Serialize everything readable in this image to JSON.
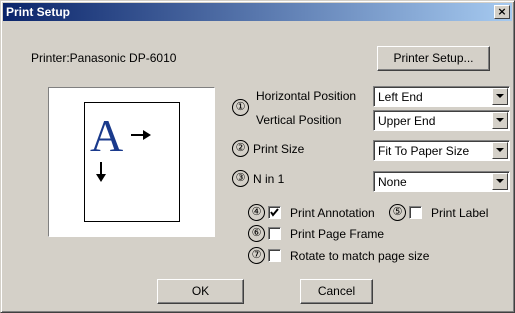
{
  "window": {
    "title": "Print Setup",
    "close_glyph": "×"
  },
  "printer": {
    "label": "Printer:Panasonic DP-6010",
    "setup_button": "Printer Setup..."
  },
  "preview": {
    "letter": "A"
  },
  "settings": {
    "marker_1": "①",
    "horizontal_label": "Horizontal Position",
    "horizontal_value": "Left End",
    "vertical_label": "Vertical Position",
    "vertical_value": "Upper End",
    "marker_2": "②",
    "print_size_label": "Print Size",
    "print_size_value": "Fit To Paper Size",
    "marker_3": "③",
    "n_in_1_label": "N in 1",
    "n_in_1_value": "None"
  },
  "options": {
    "marker_4": "④",
    "print_annotation_label": "Print Annotation",
    "print_annotation_checked": true,
    "marker_5": "⑤",
    "print_label_label": "Print Label",
    "print_label_checked": false,
    "marker_6": "⑥",
    "print_page_frame_label": "Print Page Frame",
    "print_page_frame_checked": false,
    "marker_7": "⑦",
    "rotate_label": "Rotate to match page size",
    "rotate_checked": false
  },
  "buttons": {
    "ok": "OK",
    "cancel": "Cancel"
  },
  "colors": {
    "title_start": "#0a246a",
    "title_end": "#a6caf0",
    "face": "#d4d0c8",
    "preview_ink": "#1a3a8c"
  }
}
